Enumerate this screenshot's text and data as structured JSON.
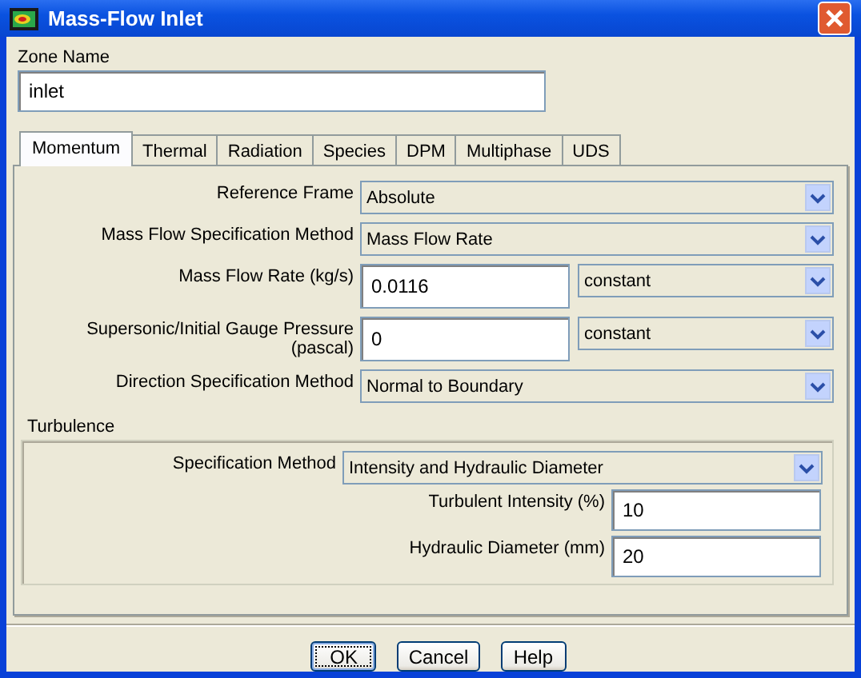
{
  "window": {
    "title": "Mass-Flow Inlet"
  },
  "zone_name": {
    "label": "Zone Name",
    "value": "inlet"
  },
  "tabs": [
    {
      "label": "Momentum",
      "selected": true
    },
    {
      "label": "Thermal",
      "selected": false
    },
    {
      "label": "Radiation",
      "selected": false
    },
    {
      "label": "Species",
      "selected": false
    },
    {
      "label": "DPM",
      "selected": false
    },
    {
      "label": "Multiphase",
      "selected": false
    },
    {
      "label": "UDS",
      "selected": false
    }
  ],
  "fields": [
    {
      "kind": "select",
      "label": "Reference Frame",
      "value": "Absolute"
    },
    {
      "kind": "select",
      "label": "Mass Flow Specification Method",
      "value": "Mass Flow Rate"
    },
    {
      "kind": "input_select",
      "label": "Mass Flow Rate (kg/s)",
      "value": "0.0116",
      "option": "constant"
    },
    {
      "kind": "input_select",
      "label": "Supersonic/Initial Gauge Pressure (pascal)",
      "value": "0",
      "option": "constant"
    },
    {
      "kind": "select",
      "label": "Direction Specification Method",
      "value": "Normal to Boundary"
    }
  ],
  "turbulence": {
    "title": "Turbulence",
    "fields": [
      {
        "kind": "select",
        "label": "Specification Method",
        "value": "Intensity and Hydraulic Diameter"
      },
      {
        "kind": "input",
        "label": "Turbulent Intensity (%)",
        "value": "10"
      },
      {
        "kind": "input",
        "label": "Hydraulic Diameter (mm)",
        "value": "20"
      }
    ]
  },
  "buttons": [
    {
      "label": "OK",
      "default": true
    },
    {
      "label": "Cancel",
      "default": false
    },
    {
      "label": "Help",
      "default": false
    }
  ]
}
